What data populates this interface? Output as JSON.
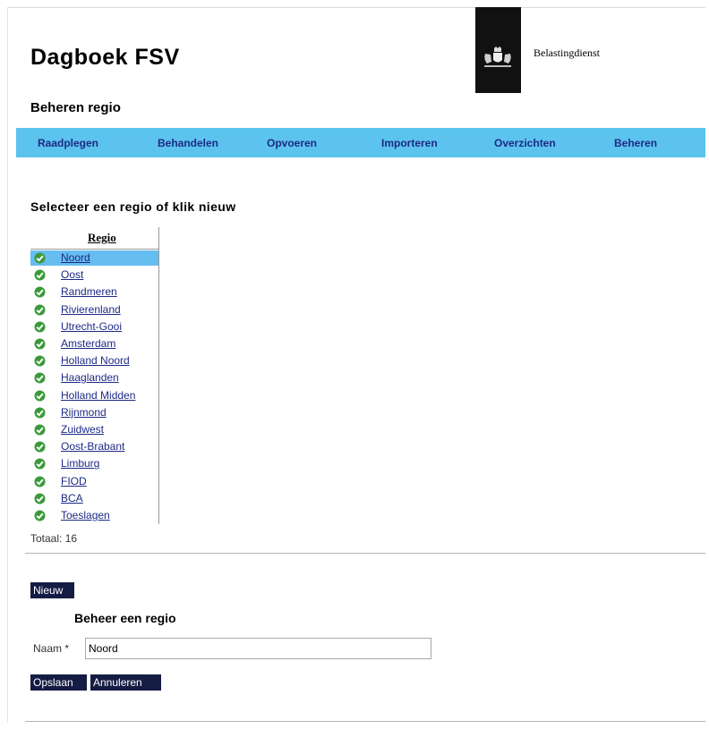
{
  "header": {
    "app_title": "Dagboek FSV",
    "org_name": "Belastingdienst",
    "page_subtitle": "Beheren regio"
  },
  "nav": {
    "items": [
      "Raadplegen",
      "Behandelen",
      "Opvoeren",
      "Importeren",
      "Overzichten",
      "Beheren"
    ]
  },
  "select_section": {
    "heading": "Selecteer een regio of klik nieuw",
    "column_header": "Regio",
    "selected_index": 0,
    "regions": [
      "Noord",
      "Oost",
      "Randmeren",
      "Rivierenland",
      "Utrecht-Gooi",
      "Amsterdam",
      "Holland Noord",
      "Haaglanden",
      "Holland Midden",
      "Rijnmond",
      "Zuidwest",
      "Oost-Brabant",
      "Limburg",
      "FIOD",
      "BCA",
      "Toeslagen"
    ],
    "total_label": "Totaal: 16"
  },
  "buttons": {
    "new_label": "Nieuw",
    "save_label": "Opslaan",
    "cancel_label": "Annuleren"
  },
  "form": {
    "heading": "Beheer een regio",
    "name_label": "Naam *",
    "name_value": "Noord"
  },
  "colors": {
    "nav_bg": "#5cc3ee",
    "link": "#1d2a86",
    "selected_row": "#66bdf0",
    "button_bg": "#151c44",
    "check_green": "#3a9a3a"
  }
}
